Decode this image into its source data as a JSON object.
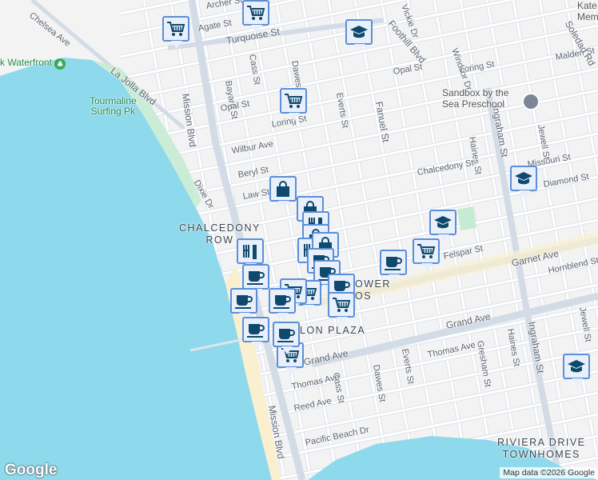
{
  "colors": {
    "water": "#8fd9ec",
    "land": "#f4f3f3",
    "park": "#c6ebd3",
    "beach": "#faefcf",
    "road": "#ffffff",
    "major_road": "#d3dce6",
    "marker_border": "#5b8fd8",
    "marker_icon": "#0f4a6e"
  },
  "streets": [
    "Archer St",
    "Agate St",
    "Turquoise St",
    "Foothill Blvd",
    "Chelsea Ave",
    "La Jolla Blvd",
    "Mission Blvd",
    "Bayard St",
    "Cass St",
    "Dawes St",
    "Fanuel St",
    "Everts St",
    "Opal St",
    "Loring St",
    "Wilbur Ave",
    "Beryl St",
    "Law St",
    "Dixie Dr",
    "Chalcedony St",
    "Diamond St",
    "Missouri St",
    "Jewell St",
    "Haines St",
    "Ingraham St",
    "Felspar St",
    "Garnet Ave",
    "Hornblend St",
    "Grand Ave",
    "Thomas Ave",
    "Reed Ave",
    "Pacific Beach Dr",
    "Gresham St",
    "Malden St",
    "Windsor Dr",
    "Vickie Dr",
    "Soledad Rd",
    "Mission Blvd",
    "Cass St",
    "Dawes St",
    "Everts St",
    "Haines St",
    "Ingraham St",
    "Jewell St",
    "Opal St",
    "Loring St",
    "Thomas Ave",
    "Grand Ave"
  ],
  "areas": {
    "chalcedony": [
      "CHALCEDONY",
      "ROW"
    ],
    "crystal": "LON PLAZA",
    "tower": [
      "OWER",
      "OS"
    ],
    "riviera": [
      "RIVIERA DRIVE",
      "TOWNHOMES"
    ]
  },
  "pois": {
    "waterfront": "k Waterfront",
    "tourmaline": [
      "Tourmaline",
      "Surfing Pk"
    ],
    "preschool": [
      "Sandbox by the",
      "Sea Preschool"
    ],
    "kate": [
      "Kate",
      "Mem"
    ]
  },
  "markers": [
    "cart",
    "cart",
    "school",
    "cart",
    "school",
    "bag",
    "bag",
    "restaurant",
    "bag",
    "school",
    "cart",
    "coffee",
    "restaurant",
    "coffee",
    "restaurant",
    "bag",
    "coffee",
    "coffee",
    "coffee",
    "cart",
    "cart",
    "coffee",
    "cart",
    "coffee",
    "coffee",
    "cart",
    "school"
  ],
  "footer": {
    "logo": "Google",
    "attribution": "Map data ©2026 Google"
  }
}
